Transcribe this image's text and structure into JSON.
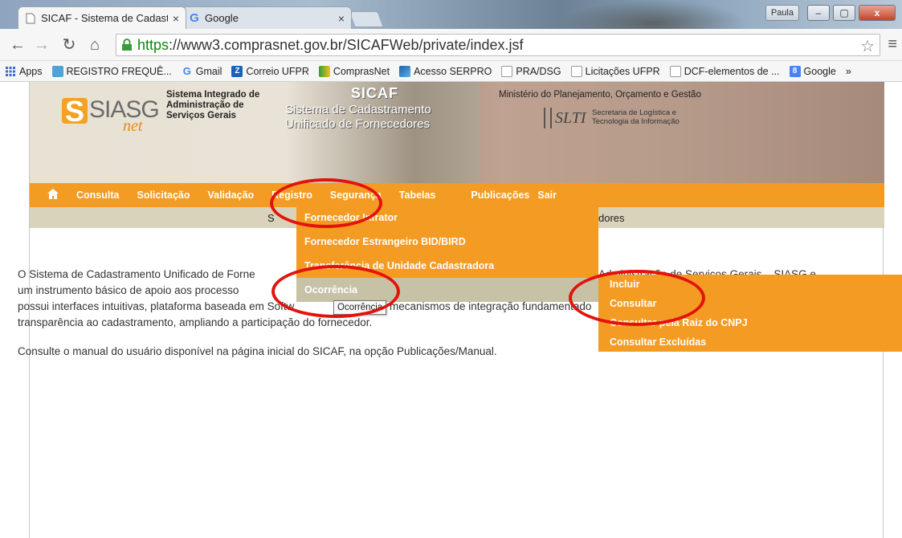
{
  "browser": {
    "tabs": [
      {
        "label": "SICAF - Sistema de Cadast",
        "close": "×"
      },
      {
        "label": "Google",
        "close": "×"
      }
    ],
    "user_badge": "Paula",
    "window_controls": {
      "minimize": "–",
      "maximize": "▢",
      "close": "x"
    },
    "url_https": "https",
    "url_rest": "://www3.comprasnet.gov.br/SICAFWeb/private/index.jsf",
    "bookmarks": [
      {
        "label": "Apps",
        "icon": "apps-grid-icon",
        "color": "#3c6dd0"
      },
      {
        "label": "REGISTRO FREQUÊ...",
        "icon": "page-icon",
        "color": "#4fa3d8"
      },
      {
        "label": "Gmail",
        "icon": "google-g-icon",
        "color": "#4285f4"
      },
      {
        "label": "Correio UFPR",
        "icon": "z-icon",
        "color": "#1b63b7"
      },
      {
        "label": "ComprasNet",
        "icon": "flag-icon",
        "color": "#2e9e3e"
      },
      {
        "label": "Acesso SERPRO",
        "icon": "serpro-icon",
        "color": "#1f5fa8"
      },
      {
        "label": "PRA/DSG",
        "icon": "page-icon",
        "color": "#888888"
      },
      {
        "label": "Licitações UFPR",
        "icon": "page-icon",
        "color": "#888888"
      },
      {
        "label": "DCF-elementos de ...",
        "icon": "page-icon",
        "color": "#888888"
      },
      {
        "label": "Google",
        "icon": "google-8-icon",
        "color": "#4285f4"
      }
    ],
    "bookmarks_more": "»"
  },
  "banner": {
    "logo_text": "SIASG",
    "logo_net": "net",
    "subtitle_lines": [
      "Sistema Integrado de",
      "Administração de",
      "Serviços Gerais"
    ],
    "sicaf": "SICAF",
    "sicaf_sub": "Sistema de Cadastramento Unificado de Fornecedores",
    "ministerio": "Ministério do Planejamento, Orçamento e Gestão",
    "slti": "SLTI",
    "slti_desc": "Secretaria de Logística e Tecnologia da Informação"
  },
  "nav": {
    "items": [
      "Consulta",
      "Solicitação",
      "Validação",
      "Registro",
      "Segurança",
      "Tabelas",
      "Publicações",
      "Sair"
    ]
  },
  "subbar": {
    "left_text": "S",
    "right_text": "dores"
  },
  "content": {
    "p1_a": "O Sistema de Cadastramento Unificado de Forne",
    "p1_b": "Administração de Serviços Gerais – SIASG e constitui",
    "p1_l2_a": "um instrumento básico de apoio aos processo",
    "p1_l3_a": "possui interfaces intuitivas, plataforma baseada em Softw",
    "p1_l3_b": "mecanismos de integração fundamentado",
    "p1_l4_a": "transparência ao cadastramento, ampliando a participação do fornecedor.",
    "p2": "Consulte o manual do usuário disponível na página inicial do SICAF, na opção Publicações/Manual."
  },
  "registro_menu": [
    "Fornecedor Infrator",
    "Fornecedor Estrangeiro BID/BIRD",
    "Transferência de Unidade Cadastradora",
    "Ocorrência"
  ],
  "ocorrencia_menu": [
    "Incluir",
    "Consultar",
    "Consultar pela Raiz do CNPJ",
    "Consultar Excluídas"
  ],
  "tooltip": "Ocorrência",
  "colors": {
    "nav_orange": "#f39b22",
    "annotation_red": "#e3120b",
    "active_gray": "#c7c1a6"
  }
}
